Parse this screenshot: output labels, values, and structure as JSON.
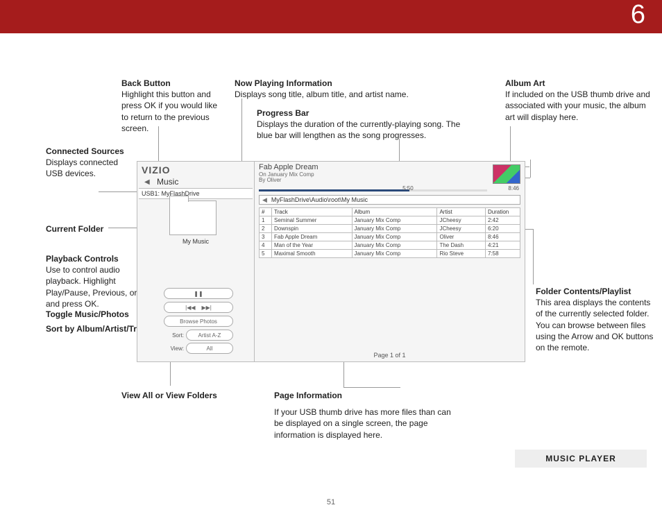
{
  "chapter_number": "6",
  "page_number": "51",
  "section_label": "MUSIC PLAYER",
  "callouts": {
    "back": {
      "title": "Back Button",
      "body": "Highlight this button and press OK if you would like to return to the previous screen."
    },
    "nowplaying": {
      "title": "Now Playing Information",
      "body": "Displays song title, album title, and artist name."
    },
    "progress": {
      "title": "Progress Bar",
      "body": "Displays the duration of the currently-playing song. The blue bar will lengthen as the song progresses."
    },
    "albumart": {
      "title": "Album Art",
      "body": "If included on the USB thumb drive and associated with your music, the album art will display here."
    },
    "sources": {
      "title": "Connected Sources",
      "body": "Displays connected USB devices."
    },
    "folder": {
      "title": "Current Folder"
    },
    "playback": {
      "title": "Playback Controls",
      "body": "Use to control audio playback. Highlight Play/Pause, Previous, or Next and press OK."
    },
    "toggle": {
      "title": "Toggle Music/Photos"
    },
    "sort": {
      "title": "Sort by Album/Artist/Track"
    },
    "viewall": {
      "title": "View All or View Folders"
    },
    "pageinfo": {
      "title": "Page Information",
      "body": "If your USB thumb drive has more files than can be displayed on a single screen, the page information is displayed here."
    },
    "contents": {
      "title": "Folder Contents/Playlist",
      "body": "This area displays the contents of the currently selected folder. You can browse between files using the Arrow and OK buttons on the remote."
    }
  },
  "player": {
    "brand": "VIZIO",
    "music_label": "Music",
    "usb_label": "USB1: MyFlashDrive",
    "folder_name": "My Music",
    "browse_photos": "Browse Photos",
    "sort_label": "Sort:",
    "sort_value": "Artist A-Z",
    "view_label": "View:",
    "view_value": "All",
    "now_playing": {
      "title": "Fab Apple Dream",
      "on_prefix": "On",
      "album": "January Mix Comp",
      "by_prefix": "By",
      "artist": "Oliver",
      "elapsed": "5:50",
      "total": "8:46",
      "progress_pct": 66
    },
    "breadcrumb": "MyFlashDrive\\Audio\\root\\My Music",
    "columns": {
      "num": "#",
      "track": "Track",
      "album": "Album",
      "artist": "Artist",
      "duration": "Duration"
    },
    "tracks": [
      {
        "n": "1",
        "track": "Seminal Summer",
        "album": "January Mix Comp",
        "artist": "JCheesy",
        "dur": "2:42"
      },
      {
        "n": "2",
        "track": "Downspin",
        "album": "January Mix Comp",
        "artist": "JCheesy",
        "dur": "6:20"
      },
      {
        "n": "3",
        "track": "Fab Apple Dream",
        "album": "January Mix Comp",
        "artist": "Oliver",
        "dur": "8:46"
      },
      {
        "n": "4",
        "track": "Man of the Year",
        "album": "January Mix Comp",
        "artist": "The Dash",
        "dur": "4:21"
      },
      {
        "n": "5",
        "track": "Maximal Smooth",
        "album": "January Mix Comp",
        "artist": "Rio Steve",
        "dur": "7:58"
      }
    ],
    "page_info": "Page 1 of 1"
  }
}
